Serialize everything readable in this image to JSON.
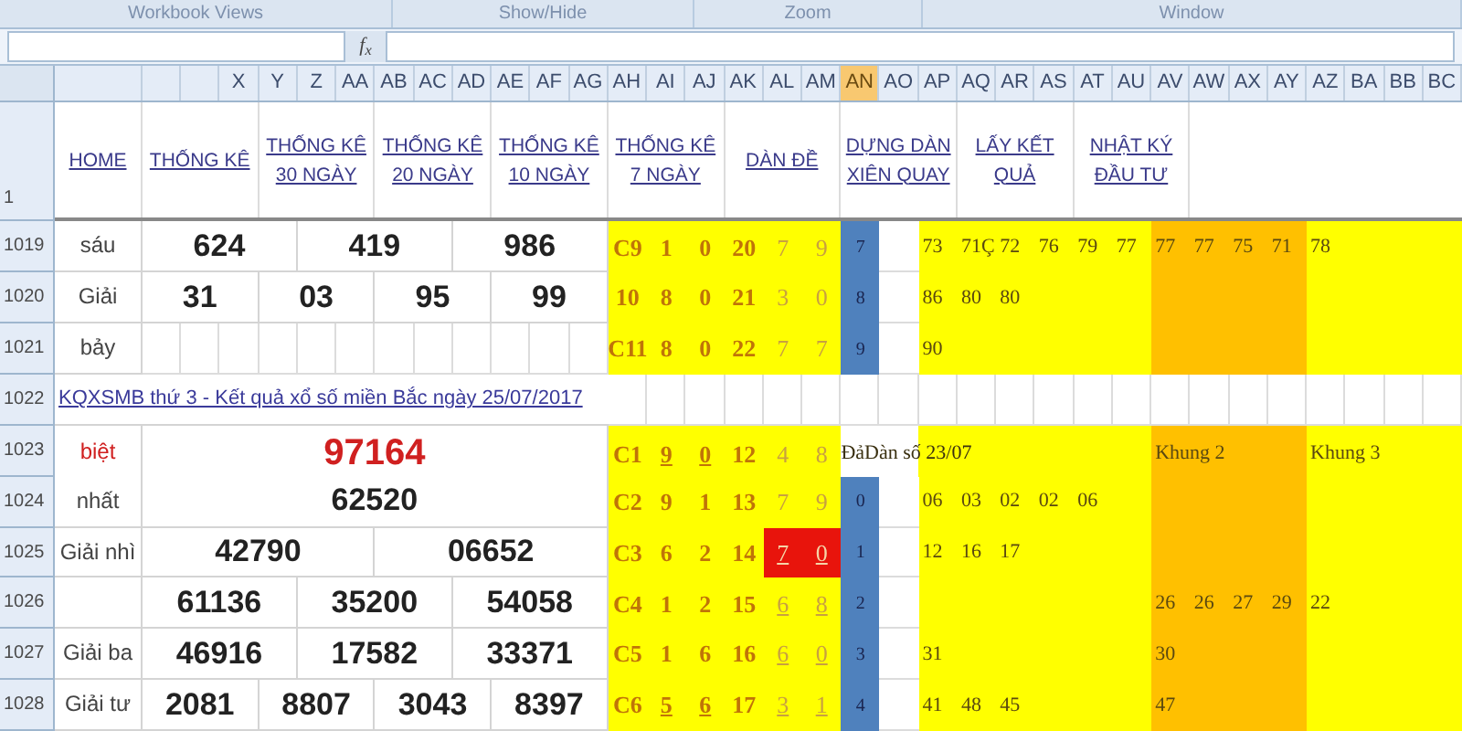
{
  "ribbon_groups": [
    "Workbook Views",
    "Show/Hide",
    "Zoom",
    "Window"
  ],
  "formula_bar": {
    "function_label": "f$_{x}$"
  },
  "column_headers": [
    {
      "label": "X",
      "selected": false
    },
    {
      "label": "Y",
      "selected": false
    },
    {
      "label": "Z",
      "selected": false
    },
    {
      "label": "AA",
      "selected": false
    },
    {
      "label": "AB",
      "selected": false
    },
    {
      "label": "AC",
      "selected": false
    },
    {
      "label": "AD",
      "selected": false
    },
    {
      "label": "AE",
      "selected": false
    },
    {
      "label": "AF",
      "selected": false
    },
    {
      "label": "AG",
      "selected": false
    },
    {
      "label": "AH",
      "selected": false
    },
    {
      "label": "AI",
      "selected": false
    },
    {
      "label": "AJ",
      "selected": false
    },
    {
      "label": "AK",
      "selected": false
    },
    {
      "label": "AL",
      "selected": false
    },
    {
      "label": "AM",
      "selected": false
    },
    {
      "label": "AN",
      "selected": true
    },
    {
      "label": "AO",
      "selected": false
    },
    {
      "label": "AP",
      "selected": false
    },
    {
      "label": "AQ",
      "selected": false
    },
    {
      "label": "AR",
      "selected": false
    },
    {
      "label": "AS",
      "selected": false
    },
    {
      "label": "AT",
      "selected": false
    },
    {
      "label": "AU",
      "selected": false
    },
    {
      "label": "AV",
      "selected": false
    },
    {
      "label": "AW",
      "selected": false
    },
    {
      "label": "AX",
      "selected": false
    },
    {
      "label": "AY",
      "selected": false
    },
    {
      "label": "AZ",
      "selected": false
    },
    {
      "label": "BA",
      "selected": false
    },
    {
      "label": "BB",
      "selected": false
    },
    {
      "label": "BC",
      "selected": false
    }
  ],
  "header_row": {
    "number": "1",
    "links": [
      "HOME",
      "THỐNG KÊ",
      "THỐNG KÊ 30 NGÀY",
      "THỐNG KÊ 20 NGÀY",
      "THỐNG KÊ 10 NGÀY",
      "THỐNG KÊ 7 NGÀY",
      "DÀN ĐỀ",
      "DỰNG DÀN XIÊN QUAY",
      "LẤY KẾT QUẢ",
      "NHẬT KÝ ĐẦU TƯ"
    ]
  },
  "rows": [
    {
      "number": "1019",
      "kind": "prize",
      "label": "sáu",
      "results": [
        "624",
        "419",
        "986"
      ],
      "stats": [
        {
          "text": "C9",
          "underlined": false,
          "highlighted": false
        },
        {
          "text": "1",
          "underlined": false,
          "highlighted": false
        },
        {
          "text": "0",
          "underlined": false,
          "highlighted": false
        },
        {
          "text": "20",
          "underlined": false,
          "highlighted": false
        },
        {
          "text": "7",
          "underlined": false,
          "highlighted": false
        },
        {
          "text": "9",
          "underlined": false,
          "highlighted": false
        }
      ],
      "index": "7",
      "frame_1": [
        "73",
        "71Ç",
        "72",
        "76",
        "79",
        "77"
      ],
      "frame_2": [
        "77",
        "77",
        "75",
        "71"
      ],
      "frame_3": [
        "78"
      ]
    },
    {
      "number": "1020",
      "kind": "prize",
      "label": "Giải",
      "results": [
        "31",
        "03",
        "95",
        "99"
      ],
      "stats": [
        {
          "text": "10",
          "underlined": false,
          "highlighted": false
        },
        {
          "text": "8",
          "underlined": false,
          "highlighted": false
        },
        {
          "text": "0",
          "underlined": false,
          "highlighted": false
        },
        {
          "text": "21",
          "underlined": false,
          "highlighted": false
        },
        {
          "text": "3",
          "underlined": false,
          "highlighted": false
        },
        {
          "text": "0",
          "underlined": false,
          "highlighted": false
        }
      ],
      "index": "8",
      "frame_1": [
        "86",
        "80",
        "80"
      ]
    },
    {
      "number": "1021",
      "kind": "prize",
      "label": "bảy",
      "stats": [
        {
          "text": "C11",
          "underlined": false,
          "highlighted": false
        },
        {
          "text": "8",
          "underlined": false,
          "highlighted": false
        },
        {
          "text": "0",
          "underlined": false,
          "highlighted": false
        },
        {
          "text": "22",
          "underlined": false,
          "highlighted": false
        },
        {
          "text": "7",
          "underlined": false,
          "highlighted": false
        },
        {
          "text": "7",
          "underlined": false,
          "highlighted": false
        }
      ],
      "index": "9",
      "frame_1": [
        "90"
      ]
    },
    {
      "number": "1022",
      "kind": "link",
      "link": "KQXSMB thứ 3 - Kết quả xổ số miền Bắc ngày 25/07/2017"
    },
    {
      "number": "1023",
      "kind": "special",
      "label": "biệt",
      "results": [
        "97164"
      ],
      "stats": [
        {
          "text": "C1",
          "underlined": false,
          "highlighted": false
        },
        {
          "text": "9",
          "underlined": true,
          "highlighted": false
        },
        {
          "text": "0",
          "underlined": true,
          "highlighted": false
        },
        {
          "text": "12",
          "underlined": false,
          "highlighted": false
        },
        {
          "text": "4",
          "underlined": false,
          "highlighted": false
        },
        {
          "text": "8",
          "underlined": false,
          "highlighted": false
        }
      ],
      "note": "ĐảDàn số 23/07",
      "frame_headings": [
        "Khung 2",
        "Khung 3"
      ]
    },
    {
      "number": "1024",
      "kind": "prize",
      "label": "nhất",
      "results": [
        "62520"
      ],
      "stats": [
        {
          "text": "C2",
          "underlined": false,
          "highlighted": false
        },
        {
          "text": "9",
          "underlined": false,
          "highlighted": false
        },
        {
          "text": "1",
          "underlined": false,
          "highlighted": false
        },
        {
          "text": "13",
          "underlined": false,
          "highlighted": false
        },
        {
          "text": "7",
          "underlined": false,
          "highlighted": false
        },
        {
          "text": "9",
          "underlined": false,
          "highlighted": false
        }
      ],
      "index": "0",
      "frame_1": [
        "06",
        "03",
        "02",
        "02",
        "06"
      ]
    },
    {
      "number": "1025",
      "kind": "prize",
      "label": "Giải nhì",
      "results": [
        "42790",
        "06652"
      ],
      "stats": [
        {
          "text": "C3",
          "underlined": false,
          "highlighted": false
        },
        {
          "text": "6",
          "underlined": false,
          "highlighted": false
        },
        {
          "text": "2",
          "underlined": false,
          "highlighted": false
        },
        {
          "text": "14",
          "underlined": false,
          "highlighted": false
        },
        {
          "text": "7",
          "underlined": true,
          "highlighted": true
        },
        {
          "text": "0",
          "underlined": true,
          "highlighted": true
        }
      ],
      "index": "1",
      "frame_1": [
        "12",
        "16",
        "17"
      ]
    },
    {
      "number": "1026",
      "kind": "prize",
      "results": [
        "61136",
        "35200",
        "54058"
      ],
      "stats": [
        {
          "text": "C4",
          "underlined": false,
          "highlighted": false
        },
        {
          "text": "1",
          "underlined": false,
          "highlighted": false
        },
        {
          "text": "2",
          "underlined": false,
          "highlighted": false
        },
        {
          "text": "15",
          "underlined": false,
          "highlighted": false
        },
        {
          "text": "6",
          "underlined": true,
          "highlighted": false
        },
        {
          "text": "8",
          "underlined": true,
          "highlighted": false
        }
      ],
      "index": "2",
      "frame_2": [
        "26",
        "26",
        "27",
        "29"
      ],
      "frame_3": [
        "22"
      ]
    },
    {
      "number": "1027",
      "kind": "prize",
      "label": "Giải ba",
      "results": [
        "46916",
        "17582",
        "33371"
      ],
      "stats": [
        {
          "text": "C5",
          "underlined": false,
          "highlighted": false
        },
        {
          "text": "1",
          "underlined": false,
          "highlighted": false
        },
        {
          "text": "6",
          "underlined": false,
          "highlighted": false
        },
        {
          "text": "16",
          "underlined": false,
          "highlighted": false
        },
        {
          "text": "6",
          "underlined": true,
          "highlighted": false
        },
        {
          "text": "0",
          "underlined": true,
          "highlighted": false
        }
      ],
      "index": "3",
      "frame_1": [
        "31"
      ],
      "frame_2": [
        "30"
      ]
    },
    {
      "number": "1028",
      "kind": "prize",
      "label": "Giải tư",
      "results": [
        "2081",
        "8807",
        "3043",
        "8397"
      ],
      "stats": [
        {
          "text": "C6",
          "underlined": false,
          "highlighted": false
        },
        {
          "text": "5",
          "underlined": true,
          "highlighted": false
        },
        {
          "text": "6",
          "underlined": true,
          "highlighted": false
        },
        {
          "text": "17",
          "underlined": false,
          "highlighted": false
        },
        {
          "text": "3",
          "underlined": true,
          "highlighted": false
        },
        {
          "text": "1",
          "underlined": true,
          "highlighted": false
        }
      ],
      "index": "4",
      "frame_1": [
        "41",
        "48",
        "45"
      ],
      "frame_2": [
        "47"
      ]
    }
  ]
}
